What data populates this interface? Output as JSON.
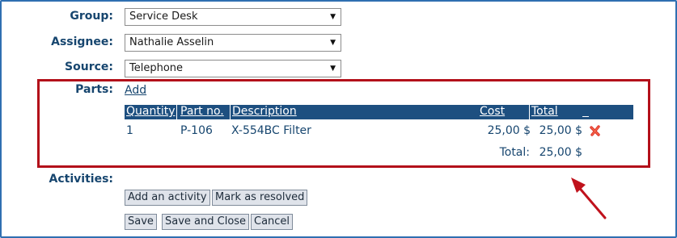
{
  "form": {
    "group": {
      "label": "Group:",
      "value": "Service Desk"
    },
    "assignee": {
      "label": "Assignee:",
      "value": "Nathalie Asselin"
    },
    "source": {
      "label": "Source:",
      "value": "Telephone"
    },
    "parts": {
      "label": "Parts:",
      "add_label": "Add",
      "columns": [
        "Quantity",
        "Part no.",
        "Description",
        "Cost",
        "Total",
        ""
      ],
      "rows": [
        {
          "quantity": "1",
          "part_no": "P-106",
          "description": "X-554BC Filter",
          "cost": "25,00 $",
          "total": "25,00 $"
        }
      ],
      "total_label": "Total:",
      "total_value": "25,00 $"
    },
    "activities": {
      "label": "Activities:"
    }
  },
  "buttons": {
    "add_activity": "Add an activity",
    "mark_resolved": "Mark as resolved",
    "save": "Save",
    "save_close": "Save and Close",
    "cancel": "Cancel"
  },
  "colors": {
    "label": "#17466f",
    "header_bg": "#1d4f80",
    "highlight_border": "#b3101a",
    "arrow": "#c0121c",
    "delete_icon": "#e0322a"
  },
  "icons": {
    "delete": "delete-x-icon",
    "pointer_arrow": "red-annotation-arrow"
  }
}
